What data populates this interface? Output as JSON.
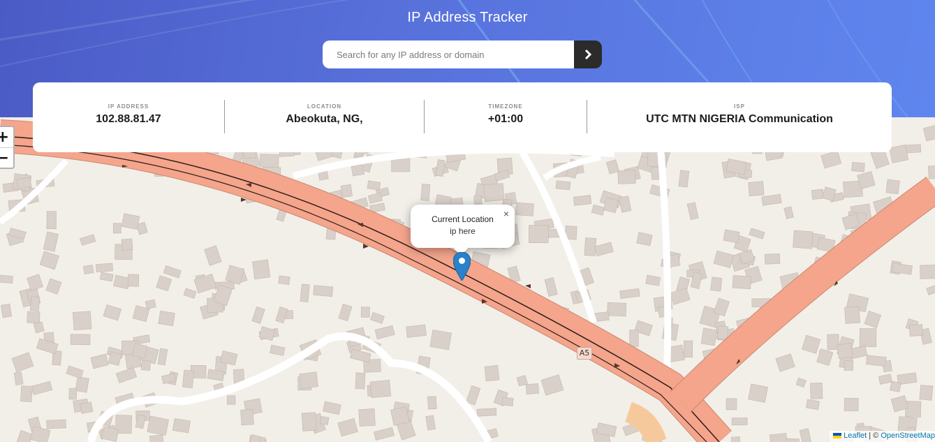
{
  "app": {
    "title": "IP Address Tracker"
  },
  "search": {
    "placeholder": "Search for any IP address or domain",
    "submit_icon": "chevron-right-icon"
  },
  "info": {
    "ip": {
      "label": "IP ADDRESS",
      "value": "102.88.81.47"
    },
    "location": {
      "label": "LOCATION",
      "value": "Abeokuta, NG,"
    },
    "timezone": {
      "label": "TIMEZONE",
      "value": "+01:00"
    },
    "isp": {
      "label": "ISP",
      "value": "UTC MTN NIGERIA Communication"
    }
  },
  "map": {
    "zoom_in": "+",
    "zoom_out": "−",
    "popup": {
      "title": "Current Location",
      "subtitle": "ip here",
      "close": "×"
    },
    "road_label": "A5",
    "attribution": {
      "leaflet": "Leaflet",
      "separator": "|",
      "copyright": "©",
      "osm": "OpenStreetMap"
    }
  },
  "colors": {
    "header_start": "#4b5bc6",
    "header_end": "#5f86ee",
    "button": "#2b2b2b",
    "road_primary": "#f4a58c",
    "map_land": "#f2efe9",
    "building": "#d9d0c9",
    "marker": "#2a81cb"
  }
}
